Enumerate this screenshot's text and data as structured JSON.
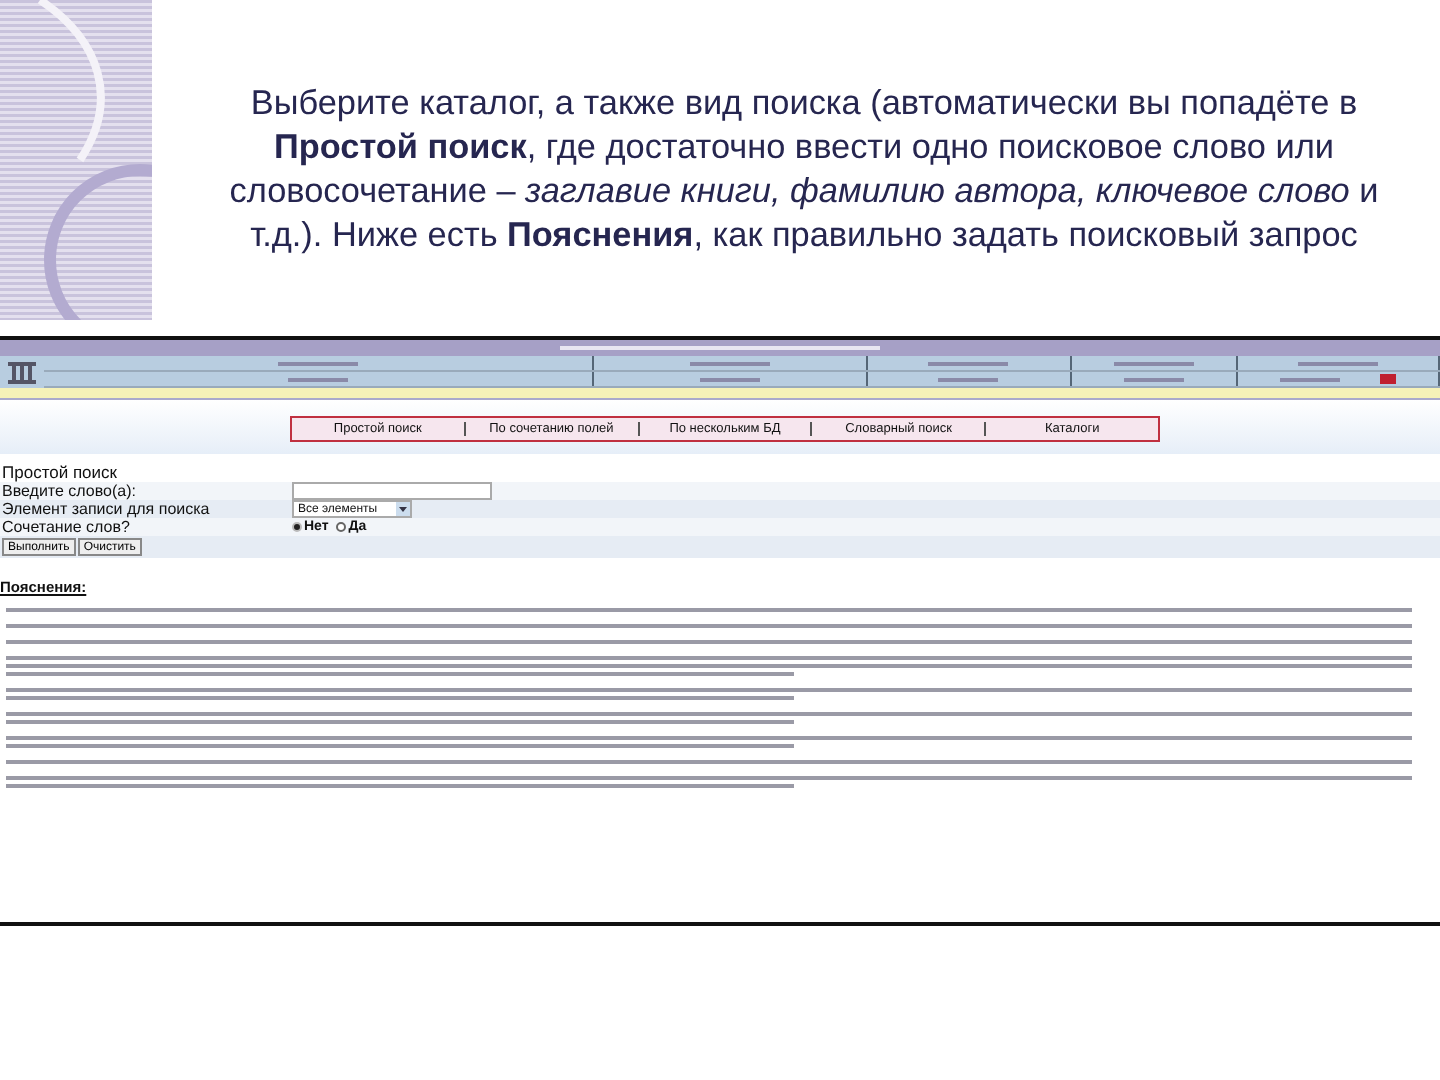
{
  "slide_text": "Выберите каталог, а также вид поиска (автоматически вы попадёте в **Простой поиск**, где достаточно ввести одно поисковое слово или словосочетание – *заглавие книги, фамилию автора, ключевое слово* и т.д.). Ниже есть **Пояснения**, как правильно задать поисковый запрос",
  "search_tabs": [
    "Простой поиск",
    "По сочетанию полей",
    "По нескольким БД",
    "Словарный поиск",
    "Каталоги"
  ],
  "form": {
    "title": "Простой поиск",
    "fields": [
      {
        "kind": "text",
        "label": "Введите слово(а):"
      },
      {
        "kind": "select",
        "label": "Элемент записи для поиска",
        "value": "Все элементы"
      },
      {
        "kind": "radio",
        "label": "Сочетание слов?",
        "options": [
          {
            "label": "Нет",
            "selected": true
          },
          {
            "label": "Да",
            "selected": false
          }
        ]
      }
    ],
    "buttons": [
      "Выполнить",
      "Очистить"
    ]
  },
  "explanations": {
    "title": "Пояснения:"
  }
}
